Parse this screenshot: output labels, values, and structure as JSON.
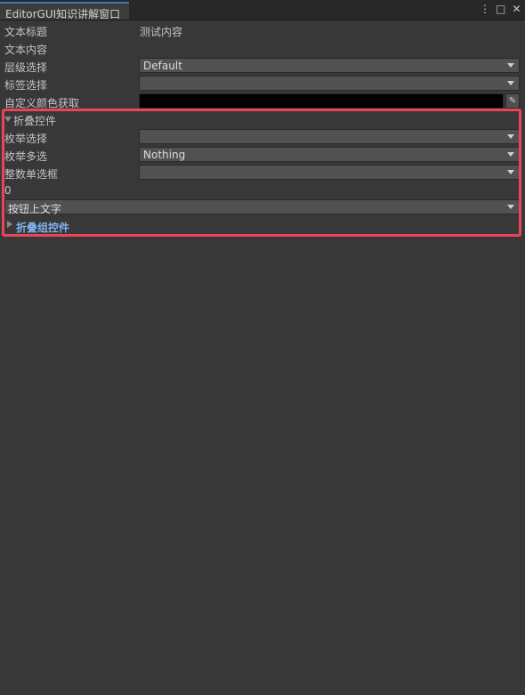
{
  "window": {
    "tab_title": "EditorGUI知识讲解窗口",
    "icons": [
      "more-vert-icon",
      "maximize-icon",
      "close-icon"
    ],
    "icon_glyphs": {
      "more": "⋮",
      "maximize": "□",
      "close": "✕"
    }
  },
  "fields": {
    "text_title_label": "文本标题",
    "text_title_value": "测试内容",
    "text_content_label": "文本内容",
    "layer_label": "层级选择",
    "layer_value": "Default",
    "tag_label": "标签选择",
    "tag_value": "",
    "color_label": "自定义颜色获取",
    "color_value": "#000000"
  },
  "foldout": {
    "label": "折叠控件",
    "expanded": true,
    "enum_label": "枚举选择",
    "enum_value": "",
    "enum_flags_label": "枚举多选",
    "enum_flags_value": "Nothing",
    "int_popup_label": "整数单选框",
    "int_popup_value": "",
    "int_value": "0",
    "button_dropdown_label": "按钮上文字"
  },
  "foldout_group": {
    "label": "折叠组控件",
    "expanded": false
  },
  "colors": {
    "background": "#383838",
    "highlight_border": "#e8455a",
    "foldout_group_text": "#7fb2f0"
  }
}
